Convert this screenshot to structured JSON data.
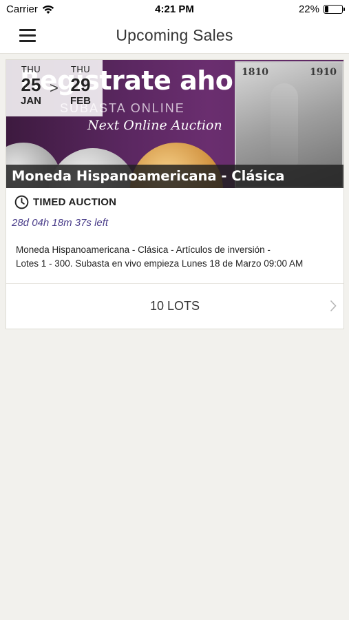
{
  "status_bar": {
    "carrier": "Carrier",
    "time": "4:21 PM",
    "battery_percent": "22%",
    "battery_level": 0.22
  },
  "nav": {
    "title": "Upcoming Sales",
    "menu_icon": "hamburger-menu-icon"
  },
  "sale": {
    "start": {
      "dow": "THU",
      "day": "25",
      "month": "JAN"
    },
    "end": {
      "dow": "THU",
      "day": "29",
      "month": "FEB"
    },
    "range_separator": ">",
    "banner": {
      "headline": "Regístrate ahora",
      "subline": "SUBASTA ONLINE",
      "script": "Next Online Auction",
      "medal_year_left": "1810",
      "medal_year_right": "1910"
    },
    "title": "Moneda Hispanoamericana - Clásica",
    "auction_type": "TIMED AUCTION",
    "time_left": "28d 04h 18m 37s left",
    "description_line1": "Moneda Hispanoamericana - Clásica - Artículos de inversión -",
    "description_line2": "Lotes 1 - 300. Subasta en vivo empieza Lunes 18 de Marzo 09:00 AM",
    "lots_label": "10 LOTS"
  },
  "colors": {
    "background": "#f2f1ed",
    "time_left": "#4a3d8a",
    "banner_purple": "#5a2760"
  }
}
